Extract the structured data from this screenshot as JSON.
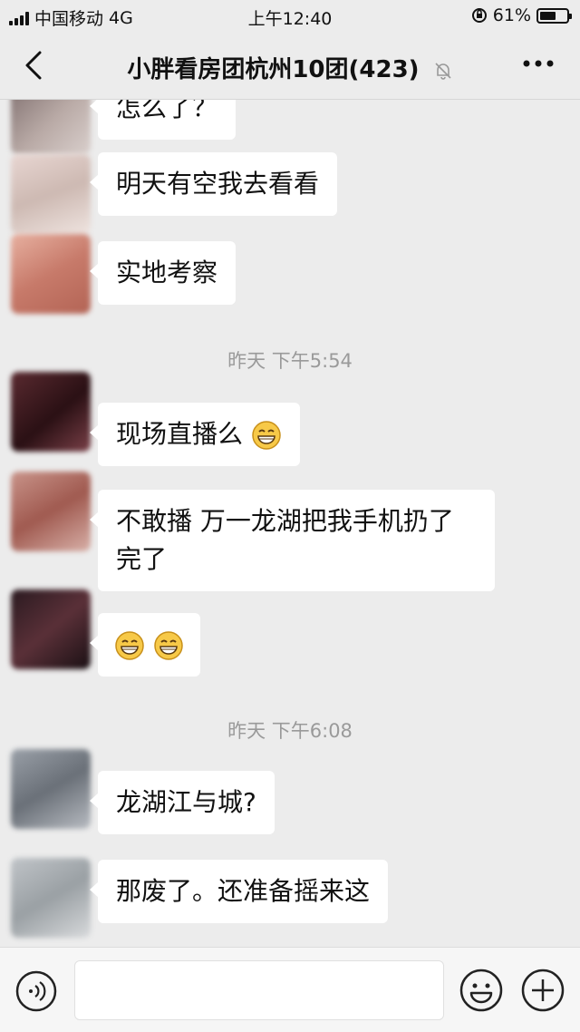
{
  "status_bar": {
    "carrier": "中国移动",
    "network": "4G",
    "time": "上午12:40",
    "battery": "61%",
    "battery_level": 0.61
  },
  "nav": {
    "title": "小胖看房团杭州10团(423)",
    "muted": true
  },
  "messages": [
    {
      "type": "bubble",
      "text": "怎么了？",
      "partial": true
    },
    {
      "type": "bubble",
      "text": "明天有空我去看看"
    },
    {
      "type": "bubble",
      "text": "实地考察"
    },
    {
      "type": "time",
      "text": "昨天 下午5:54"
    },
    {
      "type": "bubble",
      "text": "现场直播么",
      "emoji": "grin-emoji"
    },
    {
      "type": "bubble",
      "text": "不敢播 万一龙湖把我手机扔了完了",
      "line1": "不敢播 万一龙湖把我手机扔了",
      "line2": "完了"
    },
    {
      "type": "bubble",
      "text": "",
      "emoji": "grin-emoji-x2"
    },
    {
      "type": "time",
      "text": "昨天 下午6:08"
    },
    {
      "type": "bubble",
      "text": "龙湖江与城?"
    },
    {
      "type": "bubble",
      "text": "那废了。还准备摇来这"
    }
  ],
  "input_bar": {
    "left_icon": "voice-icon",
    "right_icons": [
      "emoji-icon",
      "plus-icon"
    ]
  },
  "colors": {
    "background": "#ececec",
    "bubble": "#ffffff",
    "timestamp": "#9a9a9a"
  }
}
